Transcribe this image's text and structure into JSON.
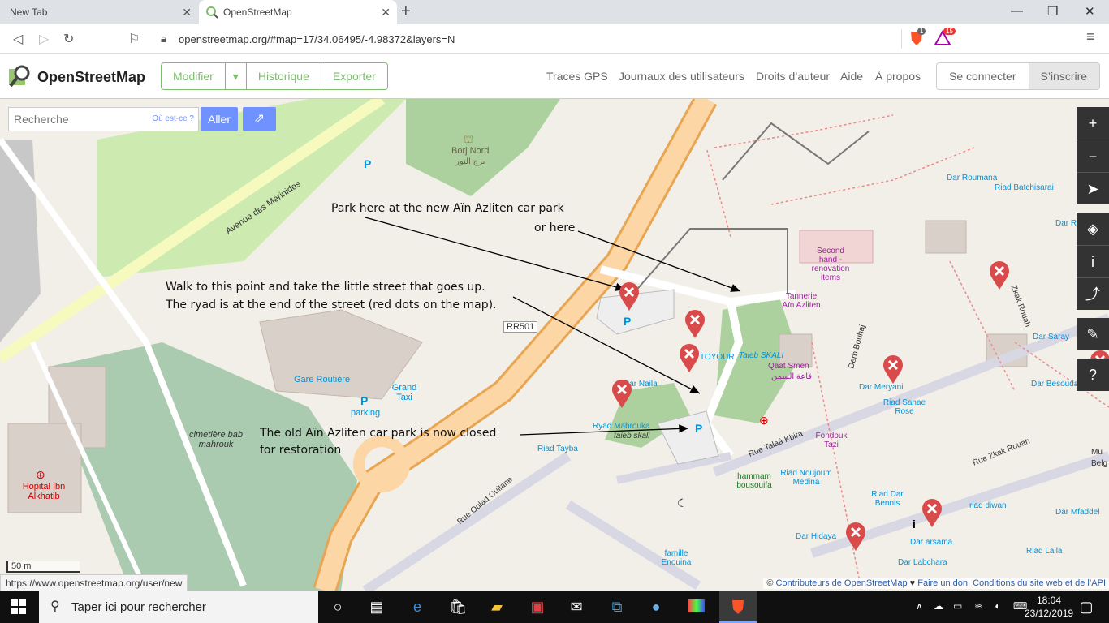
{
  "browser": {
    "tabs": [
      {
        "label": "New Tab"
      },
      {
        "label": "OpenStreetMap"
      }
    ],
    "url": "openstreetmap.org/#map=17/34.06495/-4.98372&layers=N",
    "brave_badge": "1",
    "rewards_badge": "15"
  },
  "osm": {
    "brand": "OpenStreetMap",
    "edit": "Modifier",
    "history": "Historique",
    "export": "Exporter",
    "nav": [
      "Traces GPS",
      "Journaux des utilisateurs",
      "Droits d’auteur",
      "Aide",
      "À propos"
    ],
    "login": "Se connecter",
    "signup": "S’inscrire"
  },
  "search": {
    "placeholder": "Recherche",
    "whereis": "Où est-ce ?",
    "go": "Aller"
  },
  "map": {
    "scale": "50 m",
    "status_url": "https://www.openstreetmap.org/user/new",
    "attribution_prefix": "© ",
    "attribution_contrib": "Contributeurs de OpenStreetMap",
    "attribution_heart": " ♥ ",
    "attribution_donate": "Faire un don",
    "attribution_sep": ". ",
    "attribution_terms": "Conditions du site web et de l’API",
    "labels": {
      "avenue": "Avenue des Mérinides",
      "borj": "Borj Nord",
      "borj_ar": "برج النور",
      "gare": "Gare Routière",
      "grand_taxi": "Grand Taxi",
      "parking": "parking",
      "cimetiere": "cimetière bab mahrouk",
      "hopital": "Hopital Ibn Alkhatib",
      "rr501": "RR501",
      "tannerie": "Tannerie Aïn Azliten",
      "second_hand": "Second hand - renovation items",
      "qaat": "Qaat Smen",
      "qaat_ar": "قاعة السمن",
      "taieb": "Taieb SKALI",
      "toyour": "TOYOUR",
      "dar_naila": "Dar Naila",
      "ryad_mabrouka": "Ryad Mabrouka",
      "taieb_skali2": "taieb skali",
      "riad_tayba": "Riad Tayba",
      "dar_roumana": "Dar Roumana",
      "riad_batchisarai": "Riad Batchisarai",
      "dar_saray": "Dar Saray",
      "dar_meryani": "Dar Meryani",
      "riad_sanae": "Riad Sanae Rose",
      "dar_besouda": "Dar Besouda",
      "fondouk": "Fondouk Tazi",
      "riad_noujoum": "Riad Noujoum Medina",
      "hammam": "hammam bousouifa",
      "riad_dar_bennis": "Riad Dar Bennis",
      "riad_diwan": "riad diwan",
      "dar_mfaddel": "Dar Mfaddel",
      "dar_hidaya": "Dar Hidaya",
      "dar_arsama": "Dar arsama",
      "dar_labchara": "Dar Labchara",
      "riad_laila": "Riad Laila",
      "famille": "famille Enouina",
      "rue_talaa": "Rue Talaâ Kbira",
      "rue_zkak": "Rue Zkak Rouah",
      "rue_oulad": "Rue Oulad Ouilane",
      "derb_bouhaj": "Derb Bouhaj",
      "zkak_rouah": "Zkak Rouah",
      "dar_rb": "Dar Rb",
      "mu": "Mu",
      "bel": "Belg"
    }
  },
  "annotations": {
    "park_here": "Park here at the new Aïn Azliten car park",
    "or_here": "or here",
    "walk_1": "Walk to this point and take the little street that goes up.",
    "walk_2": "The ryad is at the end of the street (red dots on the map).",
    "closed_1": "The old Aïn Azliten car park is now closed",
    "closed_2": "for restoration"
  },
  "taskbar": {
    "search_placeholder": "Taper ici pour rechercher",
    "time": "18:04",
    "date": "23/12/2019"
  }
}
